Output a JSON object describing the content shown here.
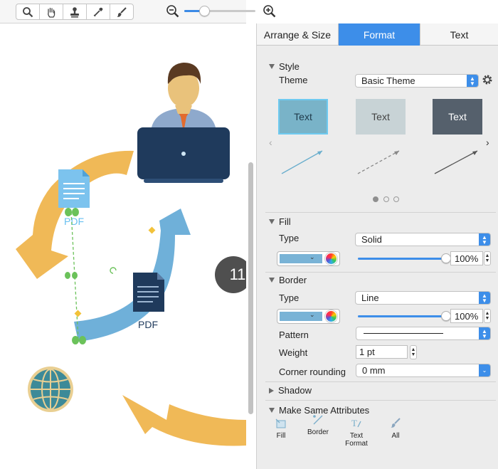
{
  "toolbar": {
    "tools": [
      "search-icon",
      "hand-icon",
      "stamp-icon",
      "eyedropper-icon",
      "brush-icon"
    ],
    "zoom_out_icon": "zoom-out-icon",
    "zoom_in_icon": "zoom-in-icon",
    "zoom_level": 0.28
  },
  "canvas": {
    "page_badge": "11",
    "pdf_label_1": "PDF",
    "pdf_label_2": "PDF",
    "colors": {
      "arrow_yellow": "#f0b957",
      "arrow_blue": "#6fb0d9",
      "laptop": "#1f3a5c",
      "globe": "#3d8a98"
    }
  },
  "panel": {
    "tabs": [
      {
        "label": "Arrange & Size",
        "active": false
      },
      {
        "label": "Format",
        "active": true
      },
      {
        "label": "Text",
        "active": false
      }
    ],
    "style": {
      "title": "Style",
      "theme_label": "Theme",
      "theme_value": "Basic Theme",
      "cards": [
        {
          "label": "Text",
          "fill": "#79b3c8",
          "selected": true
        },
        {
          "label": "Text",
          "fill": "#c8d3d6",
          "selected": false
        },
        {
          "label": "Text",
          "fill": "#55606c",
          "selected": false
        }
      ],
      "carousel_page": 1,
      "carousel_pages": 3
    },
    "fill": {
      "title": "Fill",
      "type_label": "Type",
      "type_value": "Solid",
      "color": "#79b3d6",
      "opacity": "100%"
    },
    "border": {
      "title": "Border",
      "type_label": "Type",
      "type_value": "Line",
      "color": "#79b3d6",
      "opacity": "100%",
      "pattern_label": "Pattern",
      "weight_label": "Weight",
      "weight_value": "1 pt",
      "corner_label": "Corner rounding",
      "corner_value": "0 mm"
    },
    "shadow": {
      "title": "Shadow"
    },
    "make_same": {
      "title": "Make Same Attributes",
      "items": [
        {
          "label": "Fill",
          "icon": "fill-attr-icon"
        },
        {
          "label": "Border",
          "icon": "border-attr-icon"
        },
        {
          "label": "Text\nFormat",
          "label_line1": "Text",
          "label_line2": "Format",
          "icon": "text-format-icon"
        },
        {
          "label": "All",
          "icon": "brush-all-icon"
        }
      ]
    }
  }
}
